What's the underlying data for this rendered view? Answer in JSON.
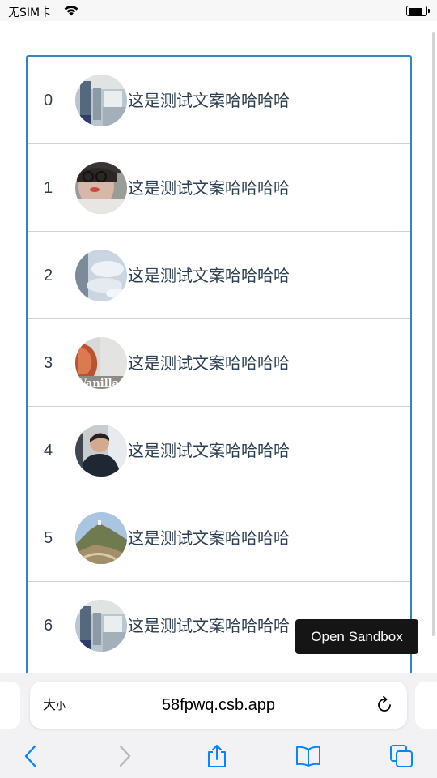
{
  "status_bar": {
    "carrier": "无SIM卡",
    "battery_level": 0.85
  },
  "list": {
    "items": [
      {
        "index": "0",
        "text": "这是测试文案哈哈哈哈",
        "avatar": "office-photo"
      },
      {
        "index": "1",
        "text": "这是测试文案哈哈哈哈",
        "avatar": "person-with-glasses"
      },
      {
        "index": "2",
        "text": "这是测试文案哈哈哈哈",
        "avatar": "sky-photo"
      },
      {
        "index": "3",
        "text": "这是测试文案哈哈哈哈",
        "avatar": "vanilla-photo"
      },
      {
        "index": "4",
        "text": "这是测试文案哈哈哈哈",
        "avatar": "person-in-car"
      },
      {
        "index": "5",
        "text": "这是测试文案哈哈哈哈",
        "avatar": "mountain-photo"
      },
      {
        "index": "6",
        "text": "这是测试文案哈哈哈哈",
        "avatar": "office-photo"
      }
    ]
  },
  "avatar_caption_3": "Vanilla",
  "open_sandbox_label": "Open Sandbox",
  "safari": {
    "reader_label_big": "大",
    "reader_label_small": "小",
    "url": "58fpwq.csb.app",
    "toolbar_icons": [
      "back-icon",
      "forward-icon",
      "share-icon",
      "bookmarks-icon",
      "tabs-icon"
    ]
  },
  "colors": {
    "list_border": "#2f86c0",
    "accent": "#0a84ff"
  }
}
